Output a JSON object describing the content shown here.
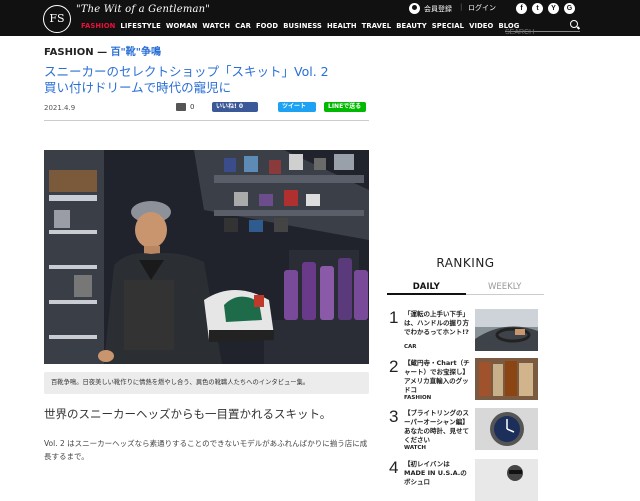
{
  "header": {
    "logo": "FS",
    "tagline": "\"The Wit of a Gentleman\"",
    "member_label": "会員登録",
    "login_label": "ログイン",
    "social": [
      "f",
      "t",
      "Y",
      "G"
    ],
    "search_placeholder": "SEARCH",
    "nav": [
      {
        "label": "FASHION",
        "active": true
      },
      {
        "label": "LIFESTYLE"
      },
      {
        "label": "WOMAN"
      },
      {
        "label": "WATCH"
      },
      {
        "label": "CAR"
      },
      {
        "label": "FOOD"
      },
      {
        "label": "BUSINESS"
      },
      {
        "label": "HEALTH"
      },
      {
        "label": "TRAVEL"
      },
      {
        "label": "BEAUTY"
      },
      {
        "label": "SPECIAL"
      },
      {
        "label": "VIDEO"
      },
      {
        "label": "BLOG"
      }
    ]
  },
  "article": {
    "category": "FASHION",
    "category_sep": " — ",
    "subcategory": "百\"靴\"争鳴",
    "title_line1": "スニーカーのセレクトショップ「スキット」Vol. 2",
    "title_line2": "買い付けドリームで時代の寵児に",
    "date": "2021.4.9",
    "comment_count": "0",
    "share_facebook": "いいね! 0",
    "share_twitter": "ツイート",
    "share_line": "LINEで送る",
    "photo_caption": "百靴争鳴。日夜美しい靴作りに情熱を燃やし合う、異色の靴職人たちへのインタビュー集。",
    "lead": "世界のスニーカーヘッズからも一目置かれるスキット。",
    "body": "Vol. 2 はスニーカーヘッズなら素通りすることのできないモデルがあふれんばかりに揃う店に成長するまで。"
  },
  "ranking": {
    "heading": "RANKING",
    "tab_daily": "DAILY",
    "tab_weekly": "WEEKLY",
    "items": [
      {
        "rank": "1",
        "title": "「運転の上手い下手」は、ハンドルの握り方でわかるってホント!?",
        "category": "CAR"
      },
      {
        "rank": "2",
        "title": "【蔵円寺・Chart（チャート）でお宝探し】アメリカ直輸入のグッドコ",
        "category": "FASHION"
      },
      {
        "rank": "3",
        "title": "【ブライトリングのスーパーオーシャン編】あなたの時計、見せてください",
        "category": "WATCH"
      },
      {
        "rank": "4",
        "title": "【初レイバンはMADE IN U.S.A.のボシュロ",
        "category": ""
      }
    ]
  },
  "colors": {
    "header_bg": "#111111",
    "accent_red": "#e8103a",
    "link_blue": "#2a6fd6",
    "facebook": "#3b5998",
    "twitter": "#1da1f2",
    "line": "#00b900"
  }
}
